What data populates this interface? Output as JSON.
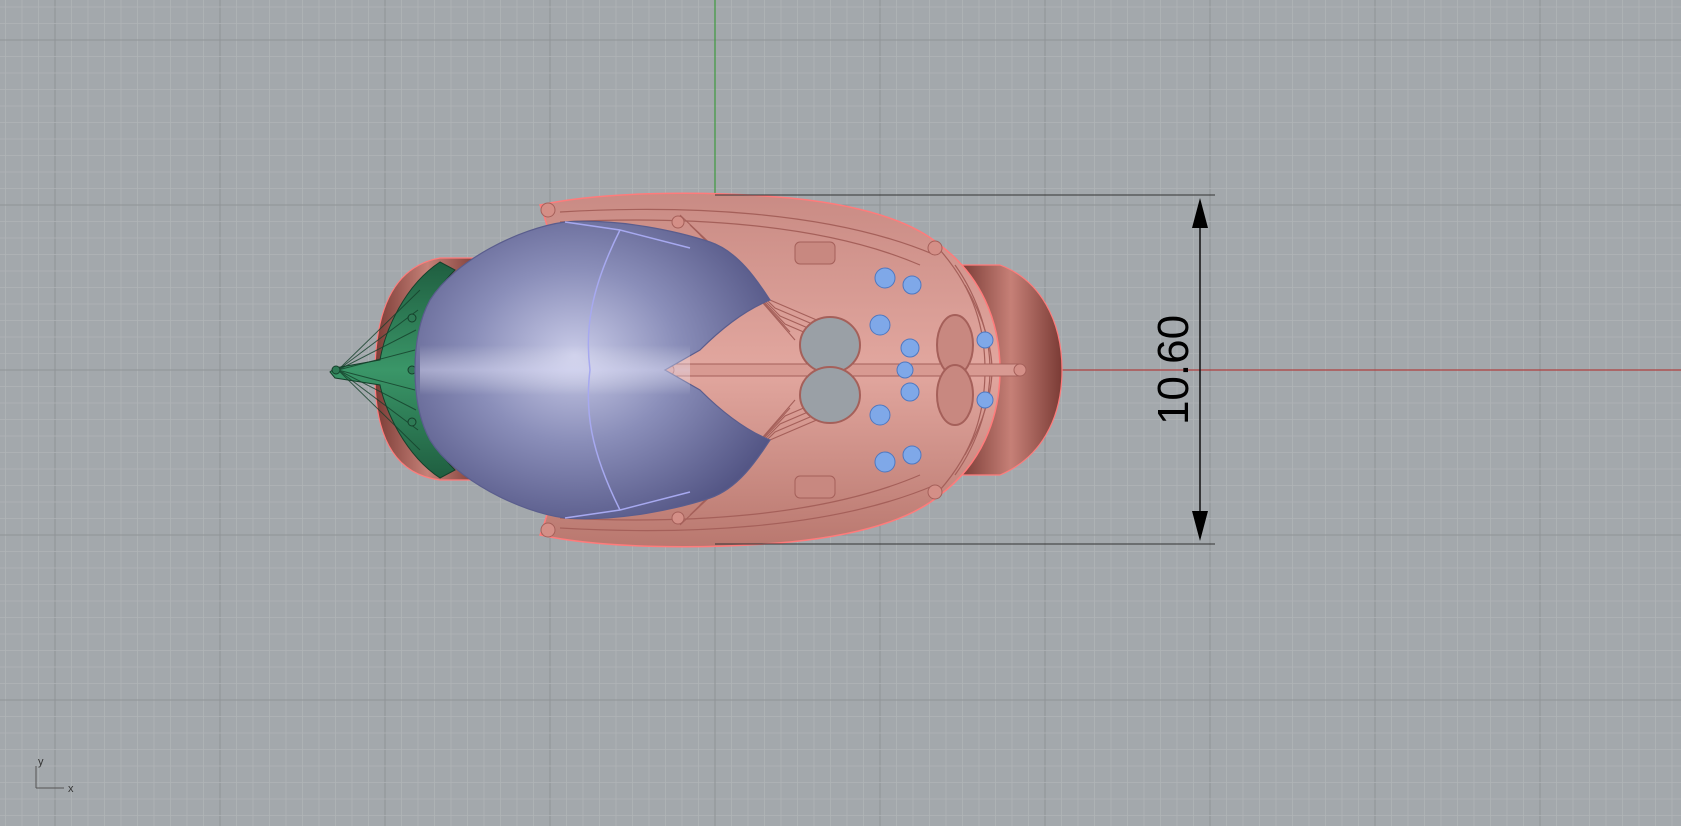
{
  "viewport": {
    "view": "Top",
    "background": "#a3a8ac",
    "grid_minor": "#b0b4b7",
    "grid_major": "#8f9396",
    "x_axis_color": "#b04040",
    "y_axis_color": "#3f9a3f"
  },
  "dimension": {
    "value": "10.60"
  },
  "axis_widget": {
    "x_label": "x",
    "y_label": "y"
  },
  "model": {
    "gem_color": "#7b7fab",
    "metal_color": "#d99a92",
    "metal_outline": "#ff7b7b",
    "prong_color": "#2e7a55",
    "accent_stone_color": "#7fa8e8"
  }
}
